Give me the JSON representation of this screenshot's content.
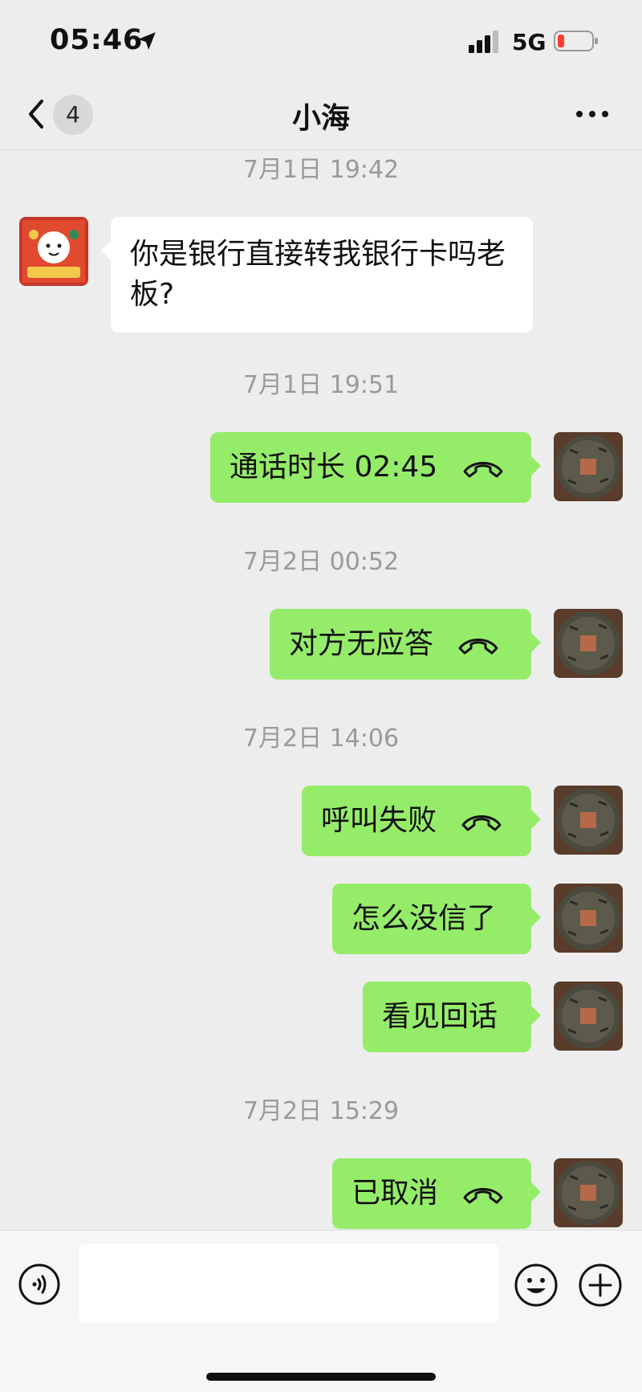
{
  "status_bar": {
    "time": "05:46",
    "network": "5G",
    "battery_color": "#ff3b30"
  },
  "nav": {
    "unread_count": "4",
    "title": "小海"
  },
  "messages": [
    {
      "type": "time",
      "text": "7月1日 19:42"
    },
    {
      "type": "text",
      "dir": "in",
      "text": "你是银行直接转我银行卡吗老板?"
    },
    {
      "type": "time",
      "text": "7月1日 19:51"
    },
    {
      "type": "call",
      "dir": "out",
      "text": "通话时长 02:45"
    },
    {
      "type": "time",
      "text": "7月2日 00:52"
    },
    {
      "type": "call",
      "dir": "out",
      "text": "对方无应答"
    },
    {
      "type": "time",
      "text": "7月2日 14:06"
    },
    {
      "type": "call",
      "dir": "out",
      "text": "呼叫失败"
    },
    {
      "type": "text",
      "dir": "out",
      "text": "怎么没信了"
    },
    {
      "type": "text",
      "dir": "out",
      "text": "看见回话"
    },
    {
      "type": "time",
      "text": "7月2日 15:29"
    },
    {
      "type": "call",
      "dir": "out",
      "text": "已取消"
    }
  ],
  "input": {
    "placeholder": ""
  },
  "colors": {
    "bubble_out": "#95ec69",
    "bubble_in": "#ffffff",
    "background": "#ededed"
  },
  "icons": {
    "location": "location-arrow-icon",
    "back": "chevron-left-icon",
    "more": "more-dots-icon",
    "call": "phone-hangup-icon",
    "voice": "voice-icon",
    "emoji": "emoji-icon",
    "plus": "plus-icon"
  }
}
